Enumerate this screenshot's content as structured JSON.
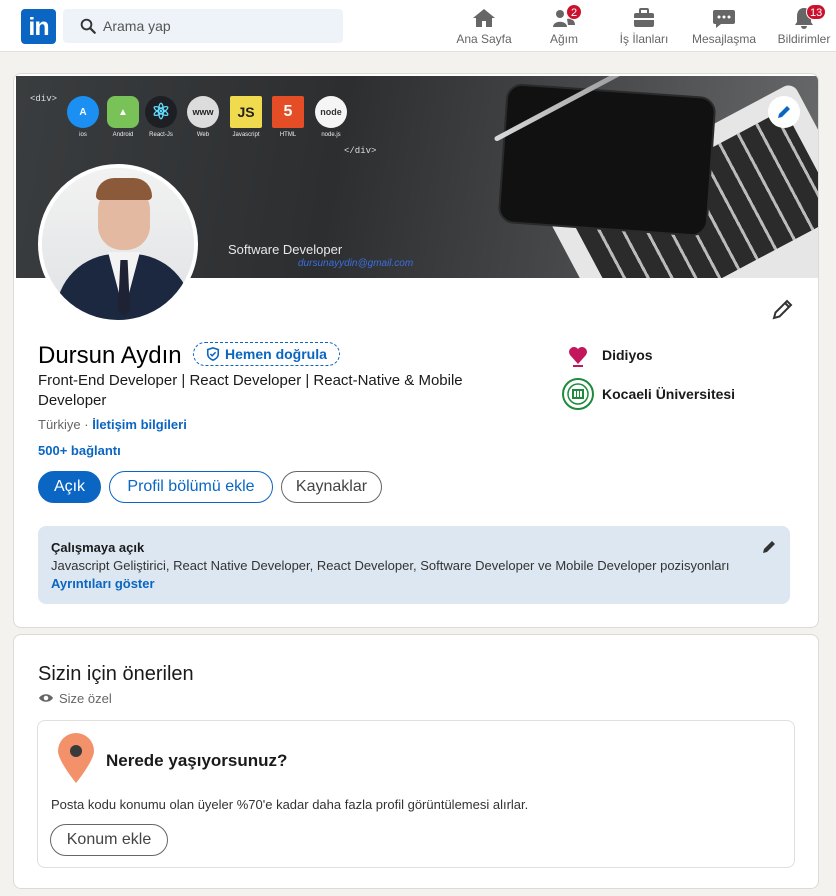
{
  "nav": {
    "logo_text": "in",
    "search_placeholder": "Arama yap",
    "items": [
      {
        "label": "Ana Sayfa",
        "icon": "home-icon",
        "badge": ""
      },
      {
        "label": "Ağım",
        "icon": "network-icon",
        "badge": "2"
      },
      {
        "label": "İş İlanları",
        "icon": "briefcase-icon",
        "badge": ""
      },
      {
        "label": "Mesajlaşma",
        "icon": "messaging-icon",
        "badge": ""
      },
      {
        "label": "Bildirimler",
        "icon": "bell-icon",
        "badge": "13"
      }
    ]
  },
  "banner": {
    "code_open": "<div>",
    "code_close": "</div>",
    "techs": [
      {
        "label": "ios",
        "icon_text": "A",
        "color": "#1b8ff2"
      },
      {
        "label": "Android",
        "icon_text": "▲",
        "color": "#78c257"
      },
      {
        "label": "React-Js",
        "icon_text": "⚛",
        "color": "#1d1f24"
      },
      {
        "label": "Web",
        "icon_text": "www",
        "color": "#dcdcdc"
      },
      {
        "label": "Javascript",
        "icon_text": "JS",
        "color": "#f0db4f"
      },
      {
        "label": "HTML",
        "icon_text": "5",
        "color": "#e44d26"
      },
      {
        "label": "node.js",
        "icon_text": "node",
        "color": "#f5f5f5"
      }
    ],
    "title": "Software Developer",
    "email": "dursunayydin@gmail.com"
  },
  "profile": {
    "name": "Dursun Aydın",
    "verify_label": "Hemen doğrula",
    "headline": "Front-End Developer | React Developer | React-Native & Mobile Developer",
    "location": "Türkiye",
    "contact_link": "İletişim bilgileri",
    "connections": "500+ bağlantı",
    "orgs": [
      {
        "name": "Didiyos",
        "logo": "didiyos-logo"
      },
      {
        "name": "Kocaeli Üniversitesi",
        "logo": "kocaeli-logo"
      }
    ],
    "buttons": {
      "open": "Açık",
      "add_section": "Profil bölümü ekle",
      "resources": "Kaynaklar"
    }
  },
  "open_to_work": {
    "title": "Çalışmaya açık",
    "text": "Javascript Geliştirici, React Native Developer, React Developer, Software Developer ve Mobile Developer pozisyonları",
    "link": "Ayrıntıları göster"
  },
  "suggested": {
    "title": "Sizin için önerilen",
    "subtitle": "Size özel",
    "question": "Nerede yaşıyorsunuz?",
    "description": "Posta kodu konumu olan üyeler %70'e kadar daha fazla profil görüntülemesi alırlar.",
    "button": "Konum ekle"
  },
  "colors": {
    "accent": "#0a66c2",
    "badge": "#cb112d",
    "open_to_work_bg": "#dde7f1"
  }
}
